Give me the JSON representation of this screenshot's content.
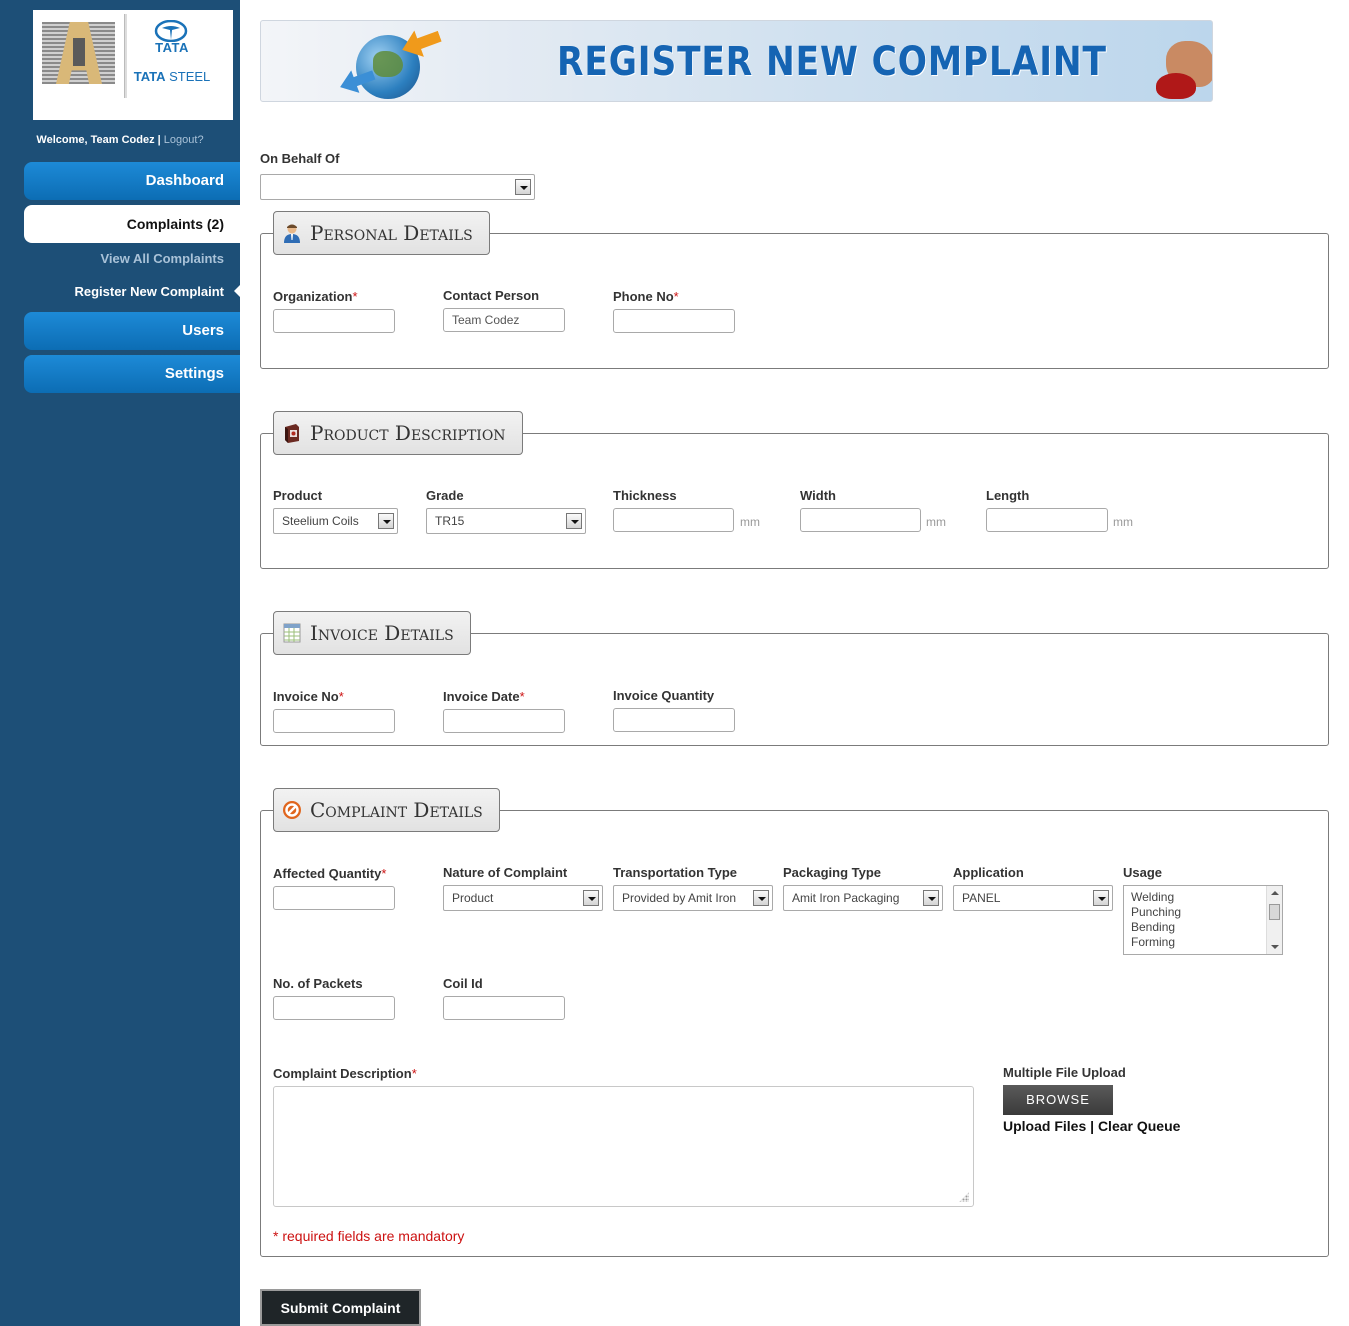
{
  "sidebar": {
    "logo": {
      "brand_top": "TATA",
      "brand_steel_bold": "TATA",
      "brand_steel_light": " STEEL"
    },
    "welcome": {
      "text": "Welcome, Team Codez | ",
      "logout": "Logout?"
    },
    "nav": {
      "dashboard": "Dashboard",
      "complaints": "Complaints (2)",
      "view_all": "View All Complaints",
      "register_new": "Register New Complaint",
      "users": "Users",
      "settings": "Settings"
    }
  },
  "banner": {
    "title": "REGISTER NEW COMPLAINT"
  },
  "form": {
    "on_behalf_of": {
      "label": "On Behalf Of",
      "value": ""
    },
    "personal": {
      "legend": "Personal Details",
      "organization": {
        "label": "Organization",
        "required": "*",
        "value": ""
      },
      "contact_person": {
        "label": "Contact Person",
        "value": "Team Codez"
      },
      "phone_no": {
        "label": "Phone No",
        "required": "*",
        "value": ""
      }
    },
    "product": {
      "legend": "Product Description",
      "product": {
        "label": "Product",
        "value": "Steelium Coils"
      },
      "grade": {
        "label": "Grade",
        "value": "TR15"
      },
      "thickness": {
        "label": "Thickness",
        "unit": "mm"
      },
      "width": {
        "label": "Width",
        "unit": "mm"
      },
      "length": {
        "label": "Length",
        "unit": "mm"
      }
    },
    "invoice": {
      "legend": "Invoice Details",
      "invoice_no": {
        "label": "Invoice No",
        "required": "*"
      },
      "invoice_date": {
        "label": "Invoice Date",
        "required": "*"
      },
      "invoice_quantity": {
        "label": "Invoice Quantity"
      }
    },
    "complaint": {
      "legend": "Complaint Details",
      "affected_quantity": {
        "label": "Affected Quantity",
        "required": "*"
      },
      "nature": {
        "label": "Nature of Complaint",
        "value": "Product"
      },
      "transportation": {
        "label": "Transportation Type",
        "value": "Provided by Amit Iron"
      },
      "packaging": {
        "label": "Packaging Type",
        "value": "Amit Iron Packaging"
      },
      "application": {
        "label": "Application",
        "value": "PANEL"
      },
      "usage": {
        "label": "Usage",
        "options": [
          "Welding",
          "Punching",
          "Bending",
          "Forming"
        ]
      },
      "packets": {
        "label": "No. of Packets"
      },
      "coil_id": {
        "label": "Coil Id"
      },
      "description": {
        "label": "Complaint Description",
        "required": "*"
      },
      "upload": {
        "label": "Multiple File Upload",
        "browse": "BROWSE",
        "upload_files": "Upload Files",
        "sep": " | ",
        "clear_queue": "Clear Queue"
      },
      "mandatory_note": "* required fields are mandatory"
    },
    "submit": "Submit Complaint"
  },
  "colors": {
    "sidebar": "#1d4f77",
    "nav_button": "#1d8ad7",
    "required": "#cc1111",
    "banner_title": "#1564b3"
  }
}
